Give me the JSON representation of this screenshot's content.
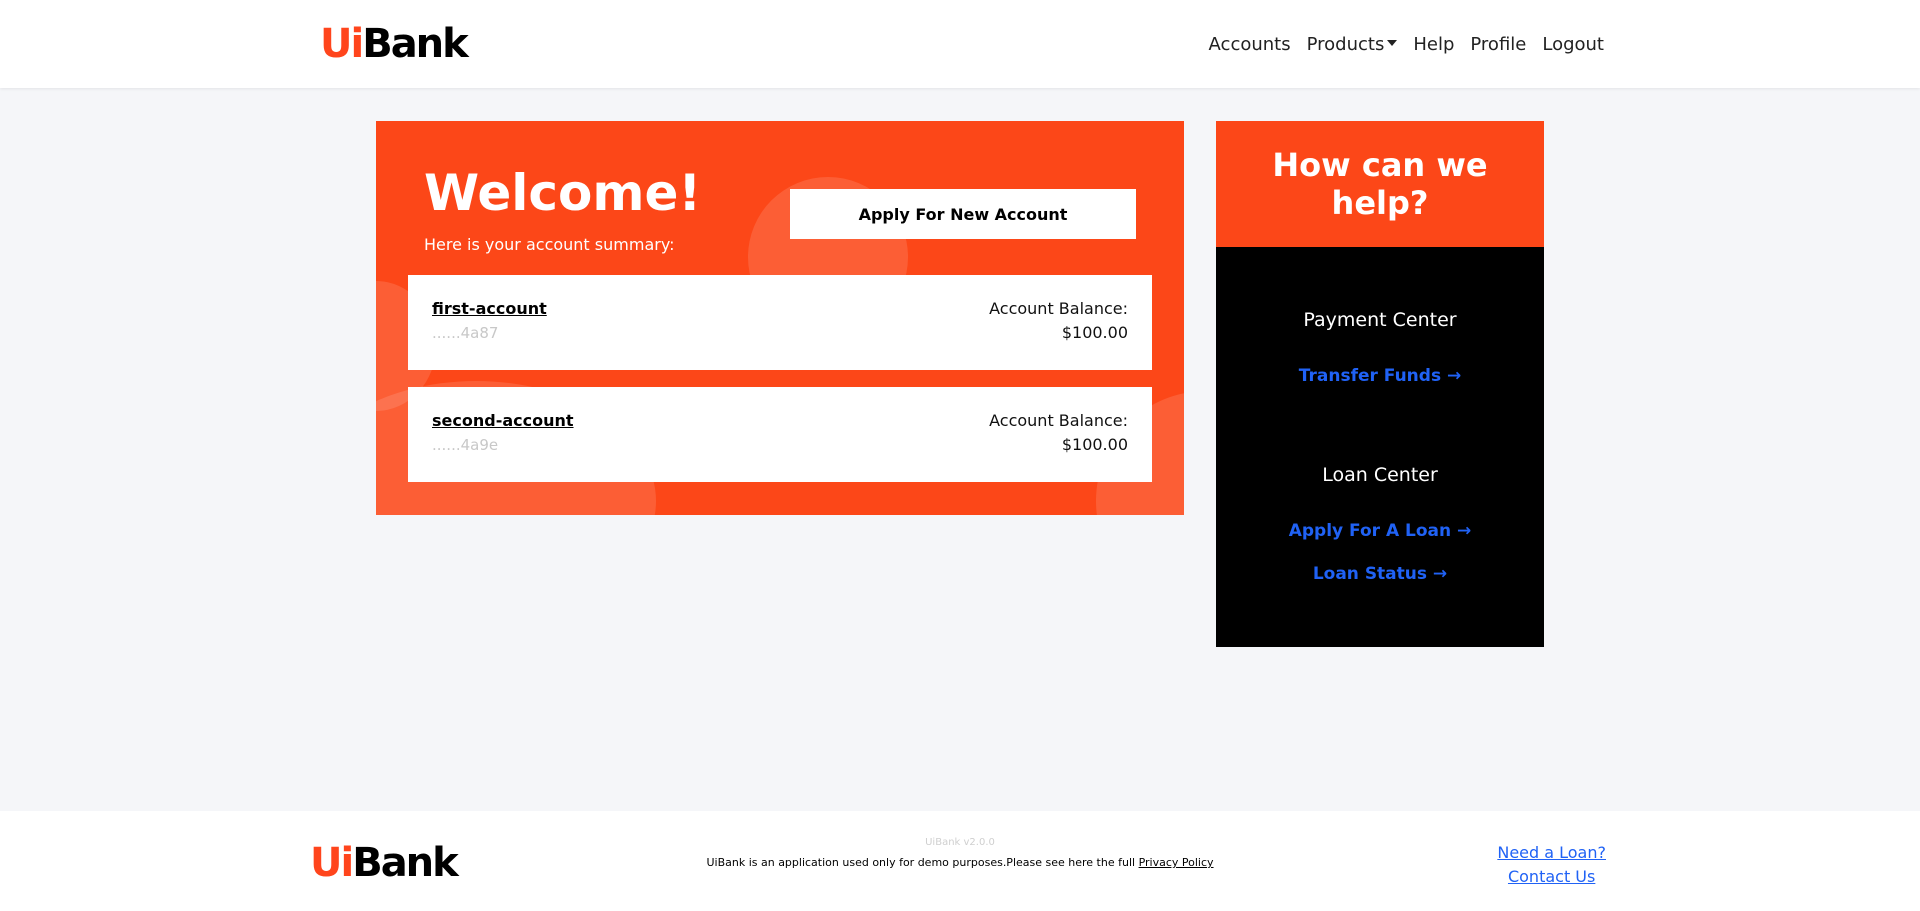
{
  "header": {
    "brand_ui": "Ui",
    "brand_bank": "Bank",
    "nav": {
      "accounts": "Accounts",
      "products": "Products",
      "help": "Help",
      "profile": "Profile",
      "logout": "Logout"
    }
  },
  "welcome": {
    "title": "Welcome!",
    "subtitle": "Here is your account summary:",
    "apply_button": "Apply For New Account"
  },
  "accounts": [
    {
      "name": "first-account",
      "number": "......4a87",
      "balance_label": "Account Balance:",
      "balance": "$100.00"
    },
    {
      "name": "second-account",
      "number": "......4a9e",
      "balance_label": "Account Balance:",
      "balance": "$100.00"
    }
  ],
  "help": {
    "title": "How can we help?",
    "payment_center": "Payment Center",
    "transfer_funds": "Transfer Funds →",
    "loan_center": "Loan Center",
    "apply_loan": "Apply For A Loan →",
    "loan_status": "Loan Status →"
  },
  "footer": {
    "brand_ui": "Ui",
    "brand_bank": "Bank",
    "version": "UiBank v2.0.0",
    "text": "UiBank is an application used only for demo purposes.Please see here the full ",
    "privacy_link": "Privacy Policy",
    "need_loan": "Need a Loan?",
    "contact_us": "Contact Us"
  },
  "colors": {
    "brand_orange": "#fc4718",
    "link_blue": "#2062f5",
    "background": "#f5f6f9"
  }
}
